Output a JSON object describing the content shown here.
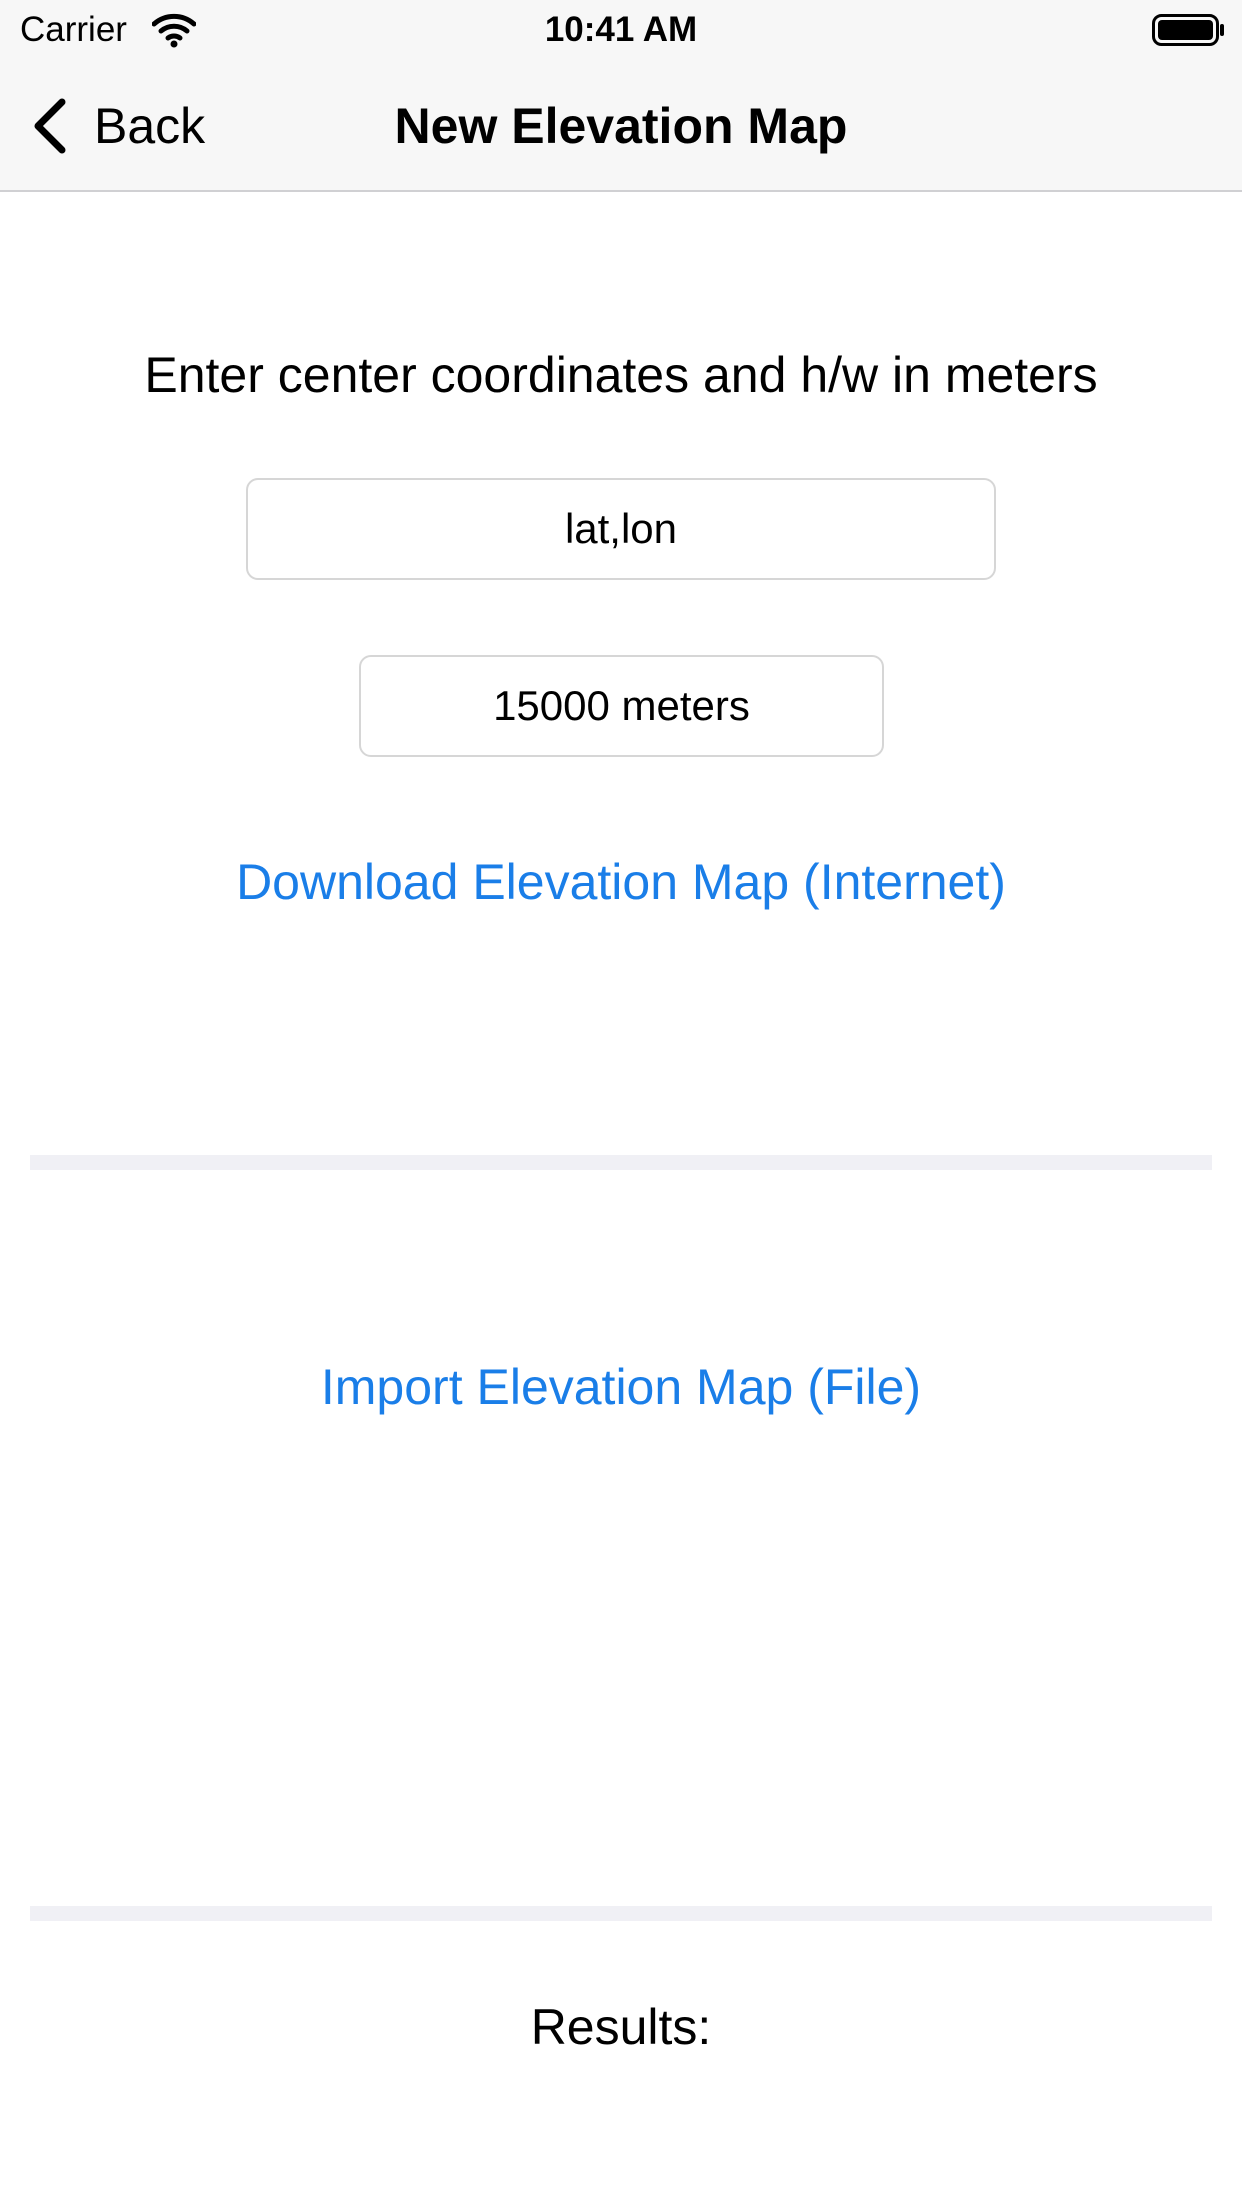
{
  "status_bar": {
    "carrier": "Carrier",
    "time": "10:41 AM",
    "wifi_icon": "wifi-icon",
    "battery_icon": "battery-icon"
  },
  "nav": {
    "back_label": "Back",
    "back_icon": "chevron-left-icon",
    "title": "New Elevation Map"
  },
  "form": {
    "instruction": "Enter center coordinates and h/w in meters",
    "coordinates_placeholder": "lat,lon",
    "size_value": "15000 meters"
  },
  "actions": {
    "download_label": "Download Elevation Map (Internet)",
    "import_label": "Import Elevation Map (File)"
  },
  "results": {
    "label": "Results:"
  },
  "colors": {
    "accent": "#1a7ee8",
    "bar_background": "#f7f7f7",
    "divider": "#f0f0f5"
  }
}
